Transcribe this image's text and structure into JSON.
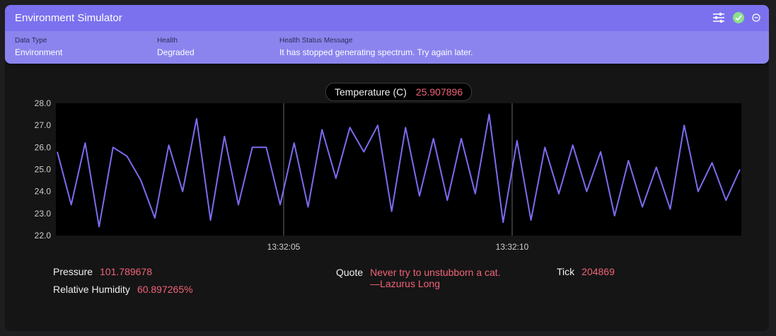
{
  "header": {
    "title": "Environment Simulator",
    "icons": [
      "sliders-icon",
      "check-circle-icon",
      "minus-circle-icon"
    ],
    "fields": [
      {
        "label": "Data Type",
        "value": "Environment"
      },
      {
        "label": "Health",
        "value": "Degraded"
      },
      {
        "label": "Health Status Message",
        "value": "It has stopped generating spectrum. Try again later."
      }
    ]
  },
  "readout": {
    "name": "Temperature (C)",
    "value": "25.907896"
  },
  "chart_data": {
    "type": "line",
    "ylim": [
      22.0,
      28.0
    ],
    "y_ticks": [
      "28.0",
      "27.0",
      "26.0",
      "25.0",
      "24.0",
      "23.0",
      "22.0"
    ],
    "x_ticks": [
      "13:32:05",
      "13:32:10"
    ],
    "grid": "vertical lines at time ticks",
    "series": [
      {
        "color": "#7b6cf0",
        "values": [
          25.8,
          23.4,
          26.2,
          22.4,
          26.0,
          25.6,
          24.5,
          22.8,
          26.1,
          24.0,
          27.3,
          22.7,
          26.5,
          23.4,
          26.0,
          26.0,
          23.4,
          26.2,
          23.3,
          26.8,
          24.6,
          26.9,
          25.8,
          27.0,
          23.1,
          26.9,
          23.8,
          26.4,
          23.6,
          26.4,
          23.9,
          27.5,
          22.6,
          26.3,
          22.7,
          26.0,
          23.9,
          26.1,
          24.0,
          25.8,
          22.9,
          25.4,
          23.3,
          25.1,
          23.2,
          27.0,
          24.0,
          25.3,
          23.6,
          25.0
        ]
      }
    ]
  },
  "stats": {
    "pressure": {
      "label": "Pressure",
      "value": "101.789678"
    },
    "humidity": {
      "label": "Relative Humidity",
      "value": "60.897265%"
    },
    "quote": {
      "label": "Quote",
      "line1": "Never try to unstubborn a cat.",
      "line2": "—Lazurus Long"
    },
    "tick": {
      "label": "Tick",
      "value": "204869"
    }
  },
  "colors": {
    "header_bar": "#7b71ef",
    "header_body": "#8b84ee",
    "accent_value": "#f06378",
    "series_line": "#7b6cf0",
    "ok_icon": "#8ce08c"
  }
}
